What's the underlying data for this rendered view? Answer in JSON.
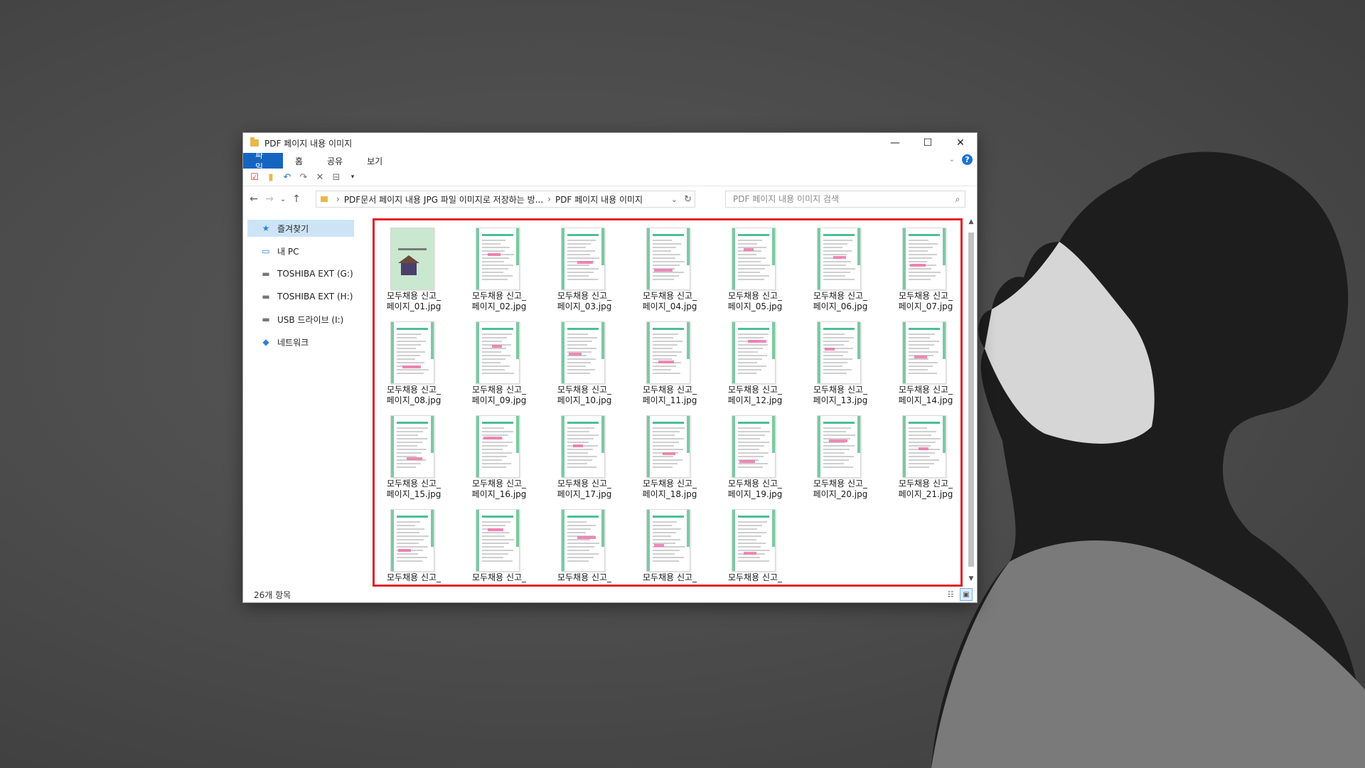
{
  "window": {
    "title": "PDF 페이지 내용 이미지",
    "controls": {
      "minimize": "—",
      "maximize": "☐",
      "close": "✕"
    }
  },
  "ribbon": {
    "tabs": [
      "파일",
      "홈",
      "공유",
      "보기"
    ],
    "help": "?"
  },
  "quick_access": {
    "icons": [
      "properties-icon",
      "new-folder-icon",
      "undo-icon",
      "redo-icon",
      "delete-icon",
      "rename-icon",
      "customize-dropdown-icon"
    ]
  },
  "address": {
    "back": "←",
    "forward": "→",
    "recent": "⌄",
    "up": "↑",
    "crumbs": [
      "PDF문서 페이지 내용 JPG 파일 이미지로 저장하는 방...",
      "PDF 페이지 내용 이미지"
    ],
    "separator": "›",
    "dropdown": "⌄",
    "refresh": "↻"
  },
  "search": {
    "placeholder": "PDF 페이지 내용 이미지 검색",
    "icon": "⌕"
  },
  "nav_pane": {
    "items": [
      {
        "label": "즐겨찾기",
        "icon": "★",
        "selected": true
      },
      {
        "label": "내 PC",
        "icon": "▭"
      },
      {
        "label": "TOSHIBA EXT (G:)",
        "icon": "▬"
      },
      {
        "label": "TOSHIBA EXT (H:)",
        "icon": "▬"
      },
      {
        "label": "USB 드라이브 (I:)",
        "icon": "▬"
      },
      {
        "label": "네트워크",
        "icon": "◆"
      }
    ]
  },
  "files": [
    {
      "line1": "모두채용 신고_",
      "line2": "페이지_01.jpg",
      "cover": true
    },
    {
      "line1": "모두채용 신고_",
      "line2": "페이지_02.jpg"
    },
    {
      "line1": "모두채용 신고_",
      "line2": "페이지_03.jpg"
    },
    {
      "line1": "모두채용 신고_",
      "line2": "페이지_04.jpg"
    },
    {
      "line1": "모두채용 신고_",
      "line2": "페이지_05.jpg"
    },
    {
      "line1": "모두채용 신고_",
      "line2": "페이지_06.jpg"
    },
    {
      "line1": "모두채용 신고_",
      "line2": "페이지_07.jpg"
    },
    {
      "line1": "모두채용 신고_",
      "line2": "페이지_08.jpg"
    },
    {
      "line1": "모두채용 신고_",
      "line2": "페이지_09.jpg"
    },
    {
      "line1": "모두채용 신고_",
      "line2": "페이지_10.jpg"
    },
    {
      "line1": "모두채용 신고_",
      "line2": "페이지_11.jpg"
    },
    {
      "line1": "모두채용 신고_",
      "line2": "페이지_12.jpg"
    },
    {
      "line1": "모두채용 신고_",
      "line2": "페이지_13.jpg"
    },
    {
      "line1": "모두채용 신고_",
      "line2": "페이지_14.jpg"
    },
    {
      "line1": "모두채용 신고_",
      "line2": "페이지_15.jpg"
    },
    {
      "line1": "모두채용 신고_",
      "line2": "페이지_16.jpg"
    },
    {
      "line1": "모두채용 신고_",
      "line2": "페이지_17.jpg"
    },
    {
      "line1": "모두채용 신고_",
      "line2": "페이지_18.jpg"
    },
    {
      "line1": "모두채용 신고_",
      "line2": "페이지_19.jpg"
    },
    {
      "line1": "모두채용 신고_",
      "line2": "페이지_20.jpg"
    },
    {
      "line1": "모두채용 신고_",
      "line2": "페이지_21.jpg"
    },
    {
      "line1": "모두채용 신고_",
      "line2": ""
    },
    {
      "line1": "모두채용 신고_",
      "line2": ""
    },
    {
      "line1": "모두채용 신고_",
      "line2": ""
    },
    {
      "line1": "모두채용 신고_",
      "line2": ""
    },
    {
      "line1": "모두채용 신고_",
      "line2": ""
    }
  ],
  "status": {
    "count": "26개 항목"
  },
  "colors": {
    "accent": "#1565c0",
    "highlight": "#e3202a",
    "selected": "#cde4f7"
  }
}
